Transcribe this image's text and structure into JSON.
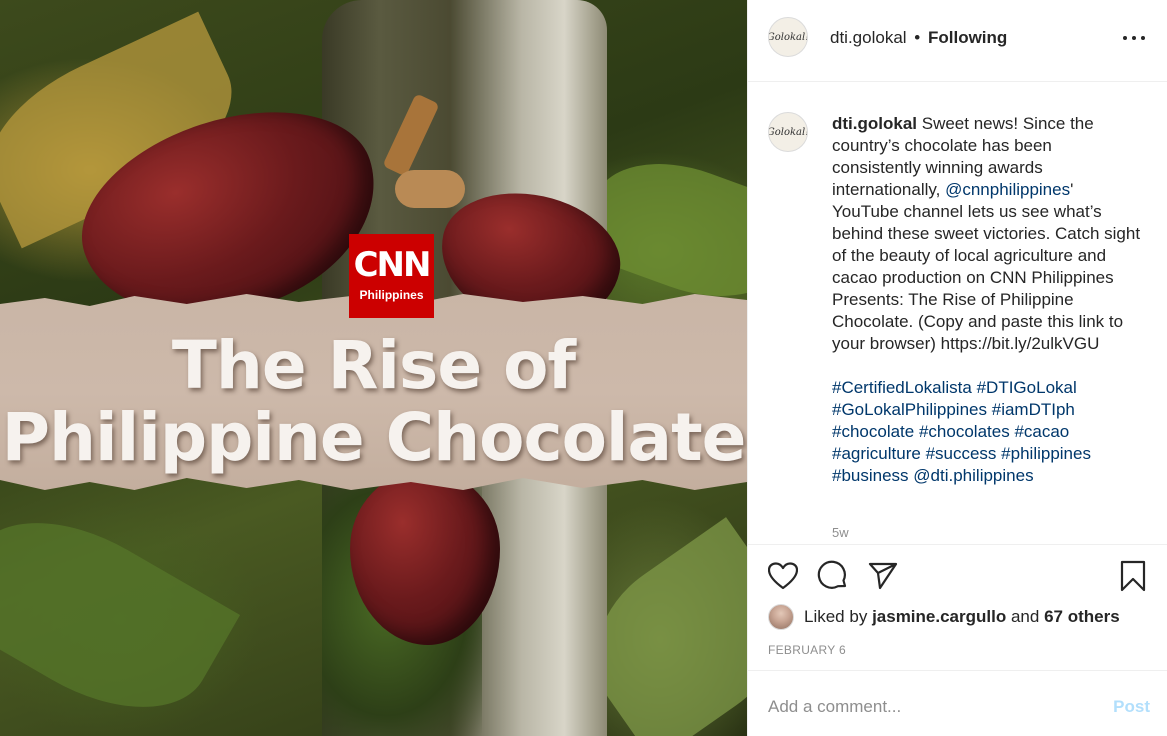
{
  "media": {
    "logo_main": "CNN",
    "logo_sub": "Philippines",
    "headline_line1": "The Rise of",
    "headline_line2": "Philippine Chocolate"
  },
  "header": {
    "avatar_text": "Golokal!",
    "username": "dti.golokal",
    "separator": "•",
    "follow_status": "Following",
    "more_icon": "more-horizontal-icon"
  },
  "caption": {
    "username": "dti.golokal",
    "text_part1": "Sweet news! Since the country’s chocolate has been consistently winning awards internationally,",
    "mention": "@cnnphilippines",
    "text_part2": "' YouTube channel lets us see what’s behind these sweet victories. Catch sight of the beauty of local agriculture and cacao production on CNN Philippines Presents: The Rise of Philippine Chocolate. (Copy and paste this link to your browser) https://bit.ly/2ulkVGU",
    "hashtags": [
      "#CertifiedLokalista",
      "#DTIGoLokal",
      "#GoLokalPhilippines",
      "#iamDTIph",
      "#chocolate",
      "#chocolates",
      "#cacao",
      "#agriculture",
      "#success",
      "#philippines",
      "#business",
      "@dti.philippines"
    ],
    "time_ago": "5w"
  },
  "actions": {
    "like_icon": "heart-icon",
    "comment_icon": "comment-icon",
    "share_icon": "paper-plane-icon",
    "save_icon": "bookmark-icon"
  },
  "likes": {
    "prefix": "Liked by",
    "user": "jasmine.cargullo",
    "and": "and",
    "others": "67 others"
  },
  "date": "FEBRUARY 6",
  "comment_box": {
    "placeholder": "Add a comment...",
    "post_label": "Post"
  },
  "colors": {
    "link": "#00376b",
    "post_disabled": "#b2dffc",
    "cnn_red": "#cc0000"
  }
}
